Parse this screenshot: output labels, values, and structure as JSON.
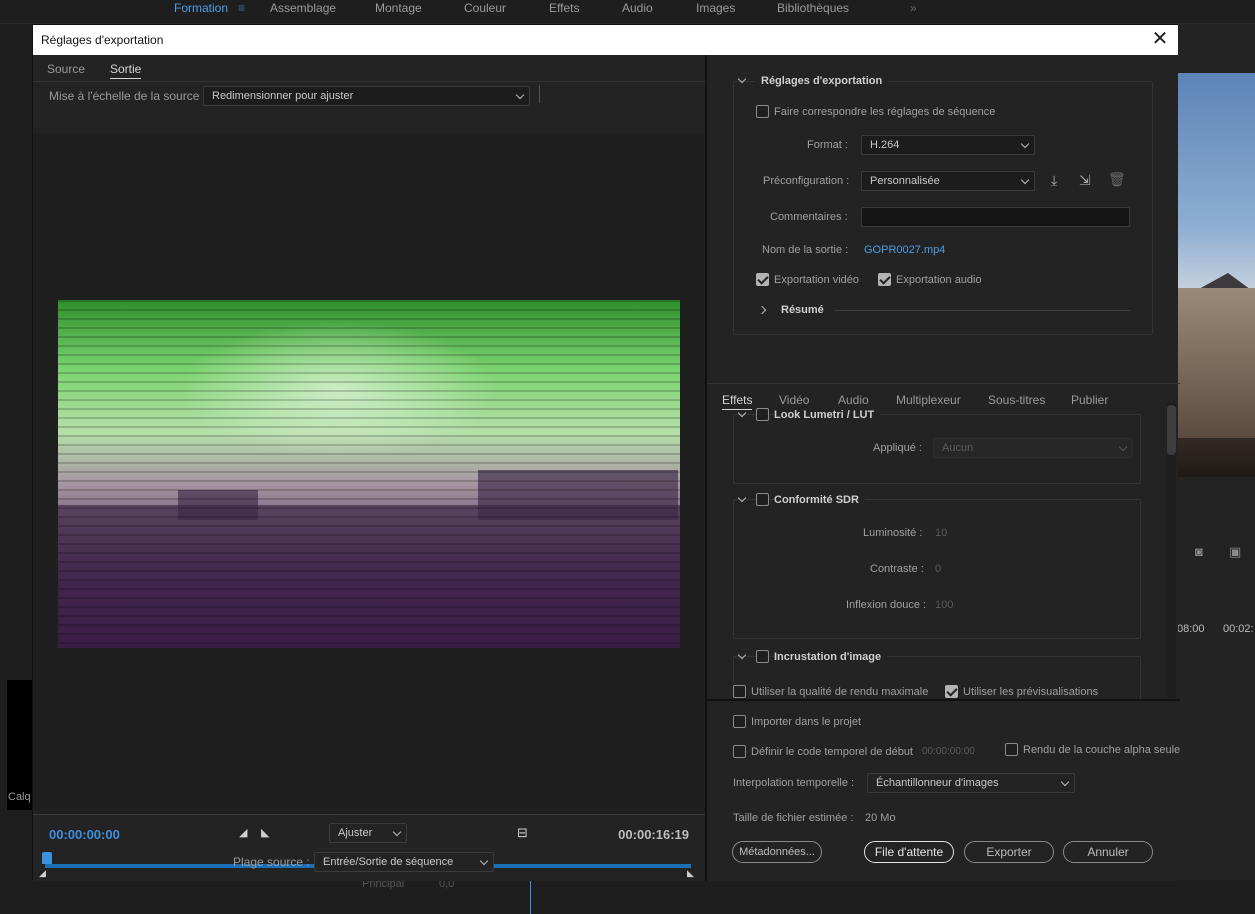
{
  "workspace_tabs": [
    "Formation",
    "Assemblage",
    "Montage",
    "Couleur",
    "Effets",
    "Audio",
    "Images",
    "Bibliothèques"
  ],
  "workspace_overflow": "»",
  "background": {
    "right_times": [
      "08:00",
      "00:02:"
    ],
    "left_label": "Calq",
    "track_label": "Principal",
    "track_value": "0,0"
  },
  "dialog": {
    "title": "Réglages d'exportation",
    "close": "✕"
  },
  "left": {
    "tabs": [
      "Source",
      "Sortie"
    ],
    "selected_tab": "Sortie",
    "scale_label": "Mise à l'échelle de la source :",
    "scale_value": "Redimensionner pour ajuster",
    "timecode_in": "00:00:00:00",
    "timecode_out": "00:00:16:19",
    "fit_value": "Ajuster",
    "range_label": "Plage source :",
    "range_value": "Entrée/Sortie de séquence"
  },
  "export_settings": {
    "section_title": "Réglages d'exportation",
    "match_sequence_label": "Faire correspondre les réglages de séquence",
    "match_sequence_checked": false,
    "format_label": "Format :",
    "format_value": "H.264",
    "preset_label": "Préconfiguration :",
    "preset_value": "Personnalisée",
    "comments_label": "Commentaires :",
    "comments_value": "",
    "output_name_label": "Nom de la sortie :",
    "output_name_value": "GOPR0027.mp4",
    "export_video_label": "Exportation vidéo",
    "export_video_checked": true,
    "export_audio_label": "Exportation audio",
    "export_audio_checked": true,
    "summary_label": "Résumé"
  },
  "effects_tabs": [
    "Effets",
    "Vidéo",
    "Audio",
    "Multiplexeur",
    "Sous-titres",
    "Publier"
  ],
  "effects_selected": "Effets",
  "effects": {
    "lumetri_title": "Look Lumetri / LUT",
    "applied_label": "Appliqué :",
    "applied_value": "Aucun",
    "sdr_title": "Conformité SDR",
    "luminosity_label": "Luminosité :",
    "luminosity_value": "10",
    "contrast_label": "Contraste :",
    "contrast_value": "0",
    "soft_knee_label": "Inflexion douce :",
    "soft_knee_value": "100",
    "overlay_title": "Incrustation d'image"
  },
  "bottom": {
    "max_quality_label": "Utiliser la qualité de rendu maximale",
    "max_quality_checked": false,
    "use_previews_label": "Utiliser les prévisualisations",
    "use_previews_checked": true,
    "import_label": "Importer dans le projet",
    "import_checked": false,
    "start_tc_label": "Définir le code temporel de début",
    "start_tc_checked": false,
    "start_tc_value": "00:00:00:00",
    "alpha_label": "Rendu de la couche alpha seule",
    "alpha_checked": false,
    "interp_label": "Interpolation temporelle :",
    "interp_value": "Échantillonneur d'images",
    "filesize_label": "Taille de fichier estimée :",
    "filesize_value": "20 Mo",
    "metadata_button": "Métadonnées...",
    "queue_button": "File d'attente",
    "export_button": "Exporter",
    "cancel_button": "Annuler"
  }
}
